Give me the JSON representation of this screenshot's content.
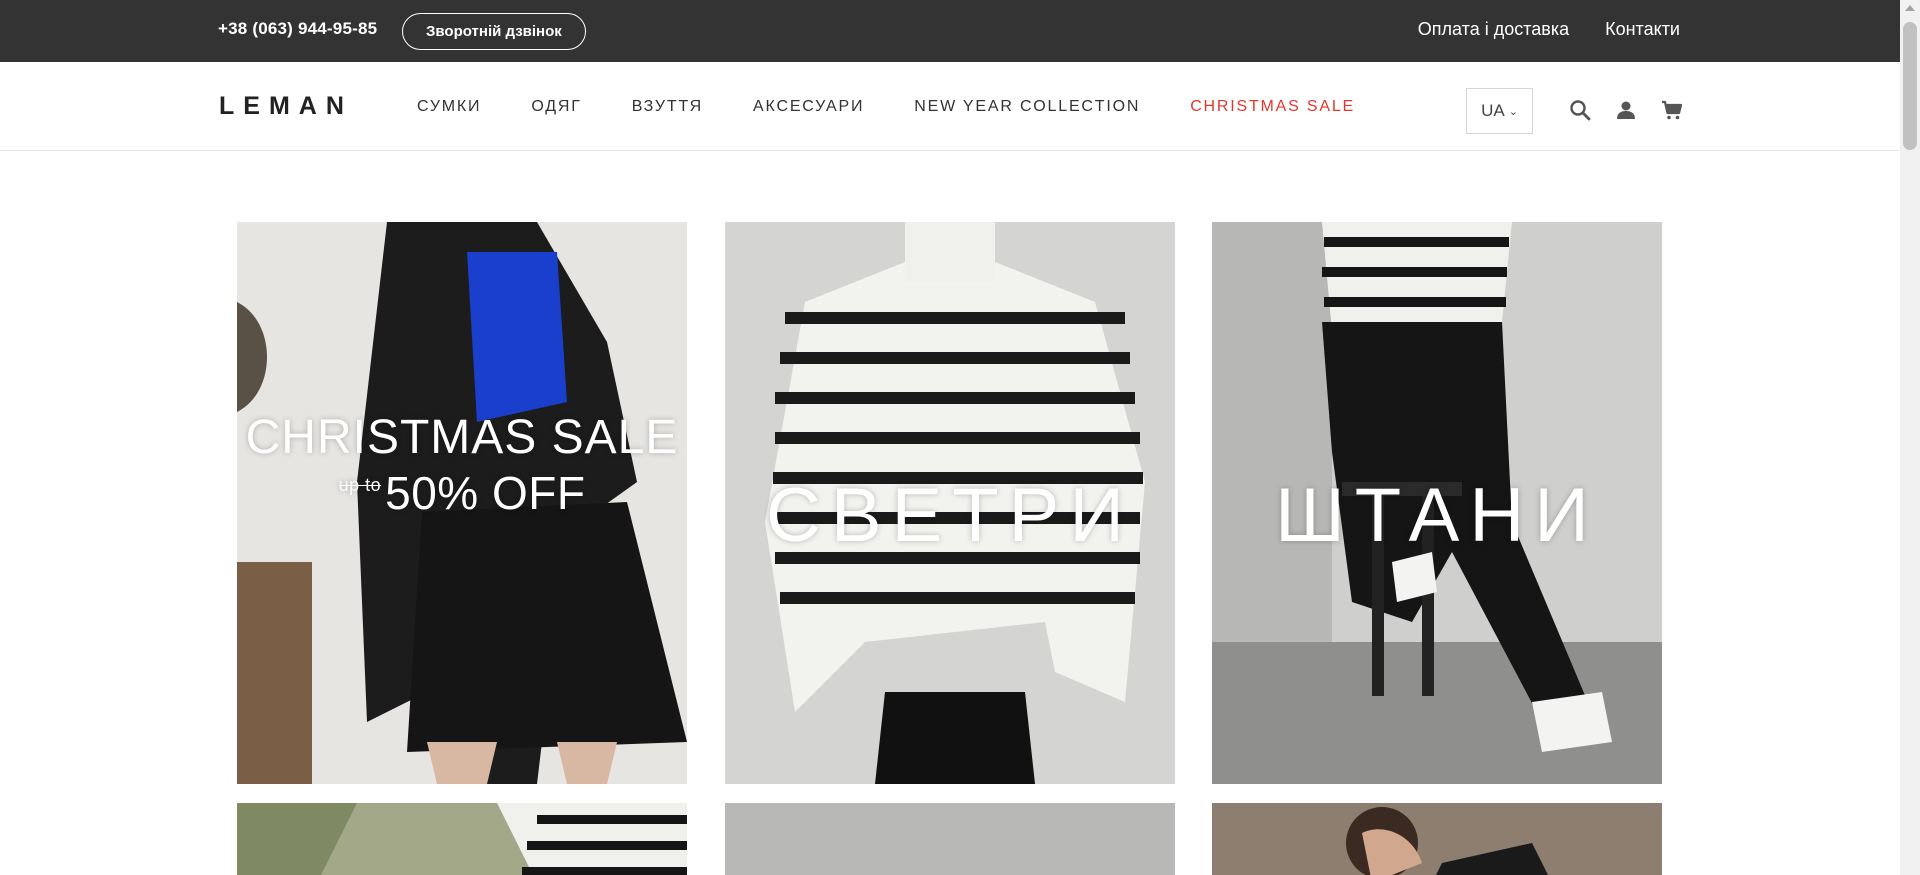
{
  "topbar": {
    "phone": "+38 (063) 944-95-85",
    "callback_label": "Зворотній дзвінок",
    "links": [
      "Оплата і доставка",
      "Контакти"
    ]
  },
  "header": {
    "logo": "LEMAN",
    "nav": [
      {
        "label": "СУМКИ"
      },
      {
        "label": "ОДЯГ"
      },
      {
        "label": "ВЗУТТЯ"
      },
      {
        "label": "АКСЕСУАРИ"
      },
      {
        "label": "NEW YEAR COLLECTION"
      },
      {
        "label": "CHRISTMAS SALE"
      }
    ],
    "language": "UA",
    "icons": [
      "search-icon",
      "user-icon",
      "cart-icon"
    ]
  },
  "tiles": [
    {
      "title": "CHRISTMAS SALE",
      "pre": "up to",
      "subtitle": "50% OFF"
    },
    {
      "title": "СВЕТРИ"
    },
    {
      "title": "ШТАНИ"
    }
  ],
  "colors": {
    "topbar_bg": "#333333",
    "sale_accent": "#e2372d",
    "text": "#333333"
  }
}
